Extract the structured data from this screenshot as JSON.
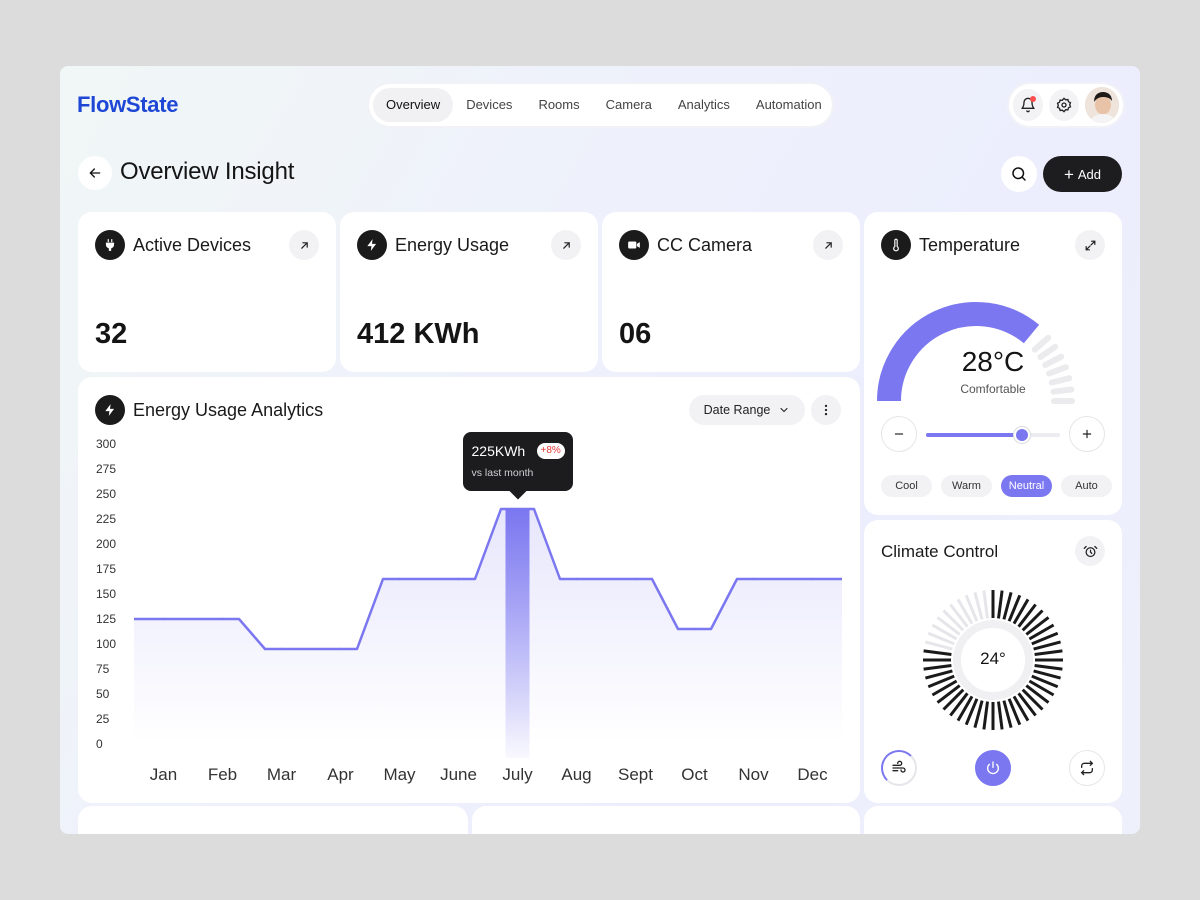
{
  "app": {
    "name": "FlowState"
  },
  "nav": {
    "items": [
      "Overview",
      "Devices",
      "Rooms",
      "Camera",
      "Analytics",
      "Automation"
    ],
    "active": "Overview"
  },
  "header": {
    "title": "Overview Insight",
    "add_label": "Add"
  },
  "stats": [
    {
      "title": "Active Devices",
      "value": "32",
      "icon": "plug-icon"
    },
    {
      "title": "Energy Usage",
      "value": "412 KWh",
      "icon": "bolt-icon"
    },
    {
      "title": "CC Camera",
      "value": "06",
      "icon": "camera-icon"
    }
  ],
  "analytics": {
    "title": "Energy Usage Analytics",
    "date_range_label": "Date Range",
    "tooltip": {
      "value": "225KWh",
      "badge": "+8%",
      "sub": "vs last month"
    }
  },
  "chart_data": {
    "type": "area",
    "categories": [
      "Jan",
      "Feb",
      "Mar",
      "Apr",
      "May",
      "June",
      "July",
      "Aug",
      "Sept",
      "Oct",
      "Nov",
      "Dec"
    ],
    "values": [
      125,
      125,
      95,
      95,
      165,
      165,
      235,
      165,
      165,
      115,
      165,
      165
    ],
    "highlight_index": 6,
    "ylim": [
      0,
      300
    ],
    "yticks": [
      300,
      275,
      250,
      225,
      200,
      175,
      150,
      125,
      100,
      75,
      50,
      25,
      0
    ],
    "color": "#7b77f0"
  },
  "temperature": {
    "title": "Temperature",
    "value": "28°C",
    "status": "Comfortable",
    "level": 0.72,
    "modes": [
      "Cool",
      "Warm",
      "Neutral",
      "Auto"
    ],
    "active_mode": "Neutral",
    "accent": "#7b77f0"
  },
  "climate": {
    "title": "Climate Control",
    "value": "24°",
    "level": 0.8
  }
}
